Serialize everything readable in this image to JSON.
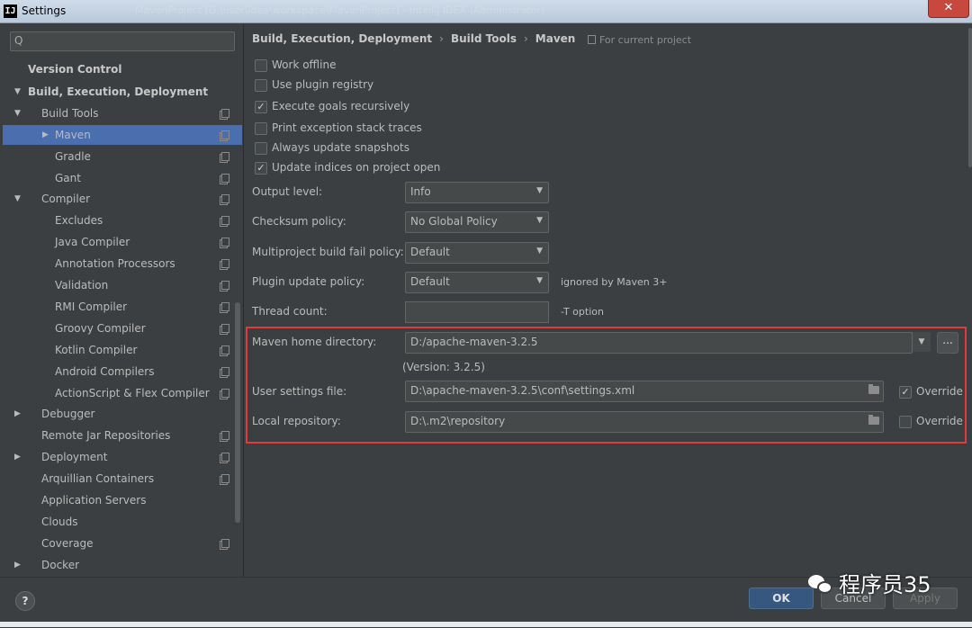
{
  "window": {
    "title": "Settings",
    "background_title": "MavenProject [D:\\user\\idea\\workspace\\MavenProject] - IntelliJ IDEA (Administrator)",
    "close_glyph": "✕",
    "app_icon_text": "IJ"
  },
  "sidebar": {
    "search_placeholder": "",
    "nodes": [
      {
        "label": "Version Control",
        "arrow": "",
        "bold": true,
        "copy": false,
        "selected": false
      },
      {
        "label": "Build, Execution, Deployment",
        "arrow": "▼",
        "bold": true,
        "copy": false,
        "selected": false
      },
      {
        "label": "Build Tools",
        "arrow": "▼",
        "bold": false,
        "copy": true,
        "selected": false
      },
      {
        "label": "Maven",
        "arrow": "▶",
        "bold": false,
        "copy": true,
        "selected": true
      },
      {
        "label": "Gradle",
        "arrow": "",
        "bold": false,
        "copy": true,
        "selected": false
      },
      {
        "label": "Gant",
        "arrow": "",
        "bold": false,
        "copy": true,
        "selected": false
      },
      {
        "label": "Compiler",
        "arrow": "▼",
        "bold": false,
        "copy": true,
        "selected": false
      },
      {
        "label": "Excludes",
        "arrow": "",
        "bold": false,
        "copy": true,
        "selected": false
      },
      {
        "label": "Java Compiler",
        "arrow": "",
        "bold": false,
        "copy": true,
        "selected": false
      },
      {
        "label": "Annotation Processors",
        "arrow": "",
        "bold": false,
        "copy": true,
        "selected": false
      },
      {
        "label": "Validation",
        "arrow": "",
        "bold": false,
        "copy": true,
        "selected": false
      },
      {
        "label": "RMI Compiler",
        "arrow": "",
        "bold": false,
        "copy": true,
        "selected": false
      },
      {
        "label": "Groovy Compiler",
        "arrow": "",
        "bold": false,
        "copy": true,
        "selected": false
      },
      {
        "label": "Kotlin Compiler",
        "arrow": "",
        "bold": false,
        "copy": true,
        "selected": false
      },
      {
        "label": "Android Compilers",
        "arrow": "",
        "bold": false,
        "copy": true,
        "selected": false
      },
      {
        "label": "ActionScript & Flex Compiler",
        "arrow": "",
        "bold": false,
        "copy": true,
        "selected": false
      },
      {
        "label": "Debugger",
        "arrow": "▶",
        "bold": false,
        "copy": false,
        "selected": false
      },
      {
        "label": "Remote Jar Repositories",
        "arrow": "",
        "bold": false,
        "copy": true,
        "selected": false
      },
      {
        "label": "Deployment",
        "arrow": "▶",
        "bold": false,
        "copy": true,
        "selected": false
      },
      {
        "label": "Arquillian Containers",
        "arrow": "",
        "bold": false,
        "copy": true,
        "selected": false
      },
      {
        "label": "Application Servers",
        "arrow": "",
        "bold": false,
        "copy": false,
        "selected": false
      },
      {
        "label": "Clouds",
        "arrow": "",
        "bold": false,
        "copy": false,
        "selected": false
      },
      {
        "label": "Coverage",
        "arrow": "",
        "bold": false,
        "copy": true,
        "selected": false
      },
      {
        "label": "Docker",
        "arrow": "▶",
        "bold": false,
        "copy": false,
        "selected": false
      }
    ]
  },
  "breadcrumb": {
    "parts": [
      "Build, Execution, Deployment",
      "Build Tools",
      "Maven"
    ],
    "separator": "›",
    "scope": "For current project"
  },
  "checkboxes": [
    {
      "label": "Work offline",
      "checked": false
    },
    {
      "label": "Use plugin registry",
      "checked": false
    },
    {
      "label": "Execute goals recursively",
      "checked": true
    },
    {
      "label": "Print exception stack traces",
      "checked": false
    },
    {
      "label": "Always update snapshots",
      "checked": false
    },
    {
      "label": "Update indices on project open",
      "checked": true
    }
  ],
  "fields": {
    "output_level": {
      "label": "Output level:",
      "value": "Info"
    },
    "checksum_policy": {
      "label": "Checksum policy:",
      "value": "No Global Policy"
    },
    "fail_policy": {
      "label": "Multiproject build fail policy:",
      "value": "Default"
    },
    "plugin_update_policy": {
      "label": "Plugin update policy:",
      "value": "Default",
      "note": "ignored by Maven 3+"
    },
    "thread_count": {
      "label": "Thread count:",
      "value": "",
      "note": "-T option"
    },
    "maven_home": {
      "label": "Maven home directory:",
      "value": "D:/apache-maven-3.2.5",
      "version": "(Version: 3.2.5)"
    },
    "user_settings": {
      "label": "User settings file:",
      "value": "D:\\apache-maven-3.2.5\\conf\\settings.xml",
      "override_label": "Override",
      "override": true
    },
    "local_repo": {
      "label": "Local repository:",
      "value": "D:\\.m2\\repository",
      "override_label": "Override",
      "override": false
    }
  },
  "glyphs": {
    "dropdown": "▼",
    "check": "✓",
    "browse": "...",
    "search": "Q"
  },
  "footer": {
    "help": "?",
    "ok": "OK",
    "cancel": "Cancel",
    "apply": "Apply",
    "watermark": "程序员35"
  },
  "colors": {
    "panel_bg": "#3c3f41",
    "selection": "#4b6eaf",
    "highlight_border": "#e0393e",
    "ok_button": "#365880"
  },
  "icons": {
    "copy": "project-scope-icon",
    "folder": "folder-icon",
    "search": "search-icon",
    "wechat": "wechat-icon"
  }
}
